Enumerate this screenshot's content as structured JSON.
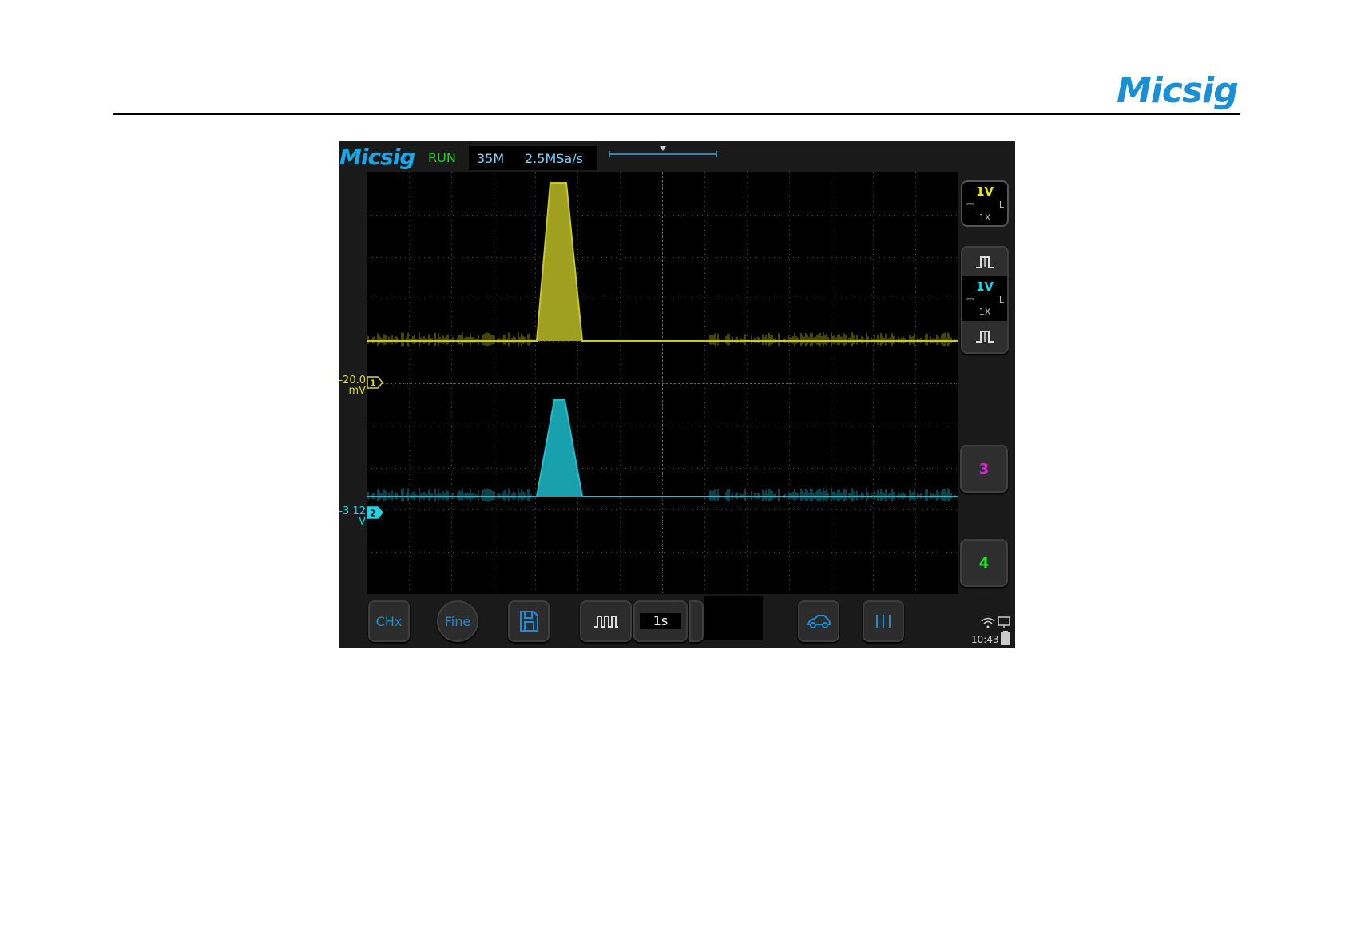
{
  "header": {
    "brand": "Micsig",
    "brand_color": "#1a8fd6"
  },
  "scope": {
    "logo": "Micsig",
    "status": "RUN",
    "memory_depth": "35M",
    "sample_rate": "2.5MSa/s",
    "channels": [
      {
        "id": "1",
        "color": "#d9d92a",
        "scale": "1V",
        "coupling_mark": "⎓",
        "bw": "L",
        "probe": "1X",
        "offset_value": "-20.0",
        "offset_unit": "mV"
      },
      {
        "id": "2",
        "color": "#22d3e6",
        "scale": "1V",
        "coupling_mark": "⎓",
        "bw": "L",
        "probe": "1X",
        "offset_value": "-3.12",
        "offset_unit": "V"
      },
      {
        "id": "3",
        "color": "#e020e0"
      },
      {
        "id": "4",
        "color": "#22e022"
      }
    ],
    "toolbar": {
      "chx": "CHx",
      "fine": "Fine",
      "timebase": "1s"
    },
    "statusbar": {
      "time": "10:43"
    }
  }
}
